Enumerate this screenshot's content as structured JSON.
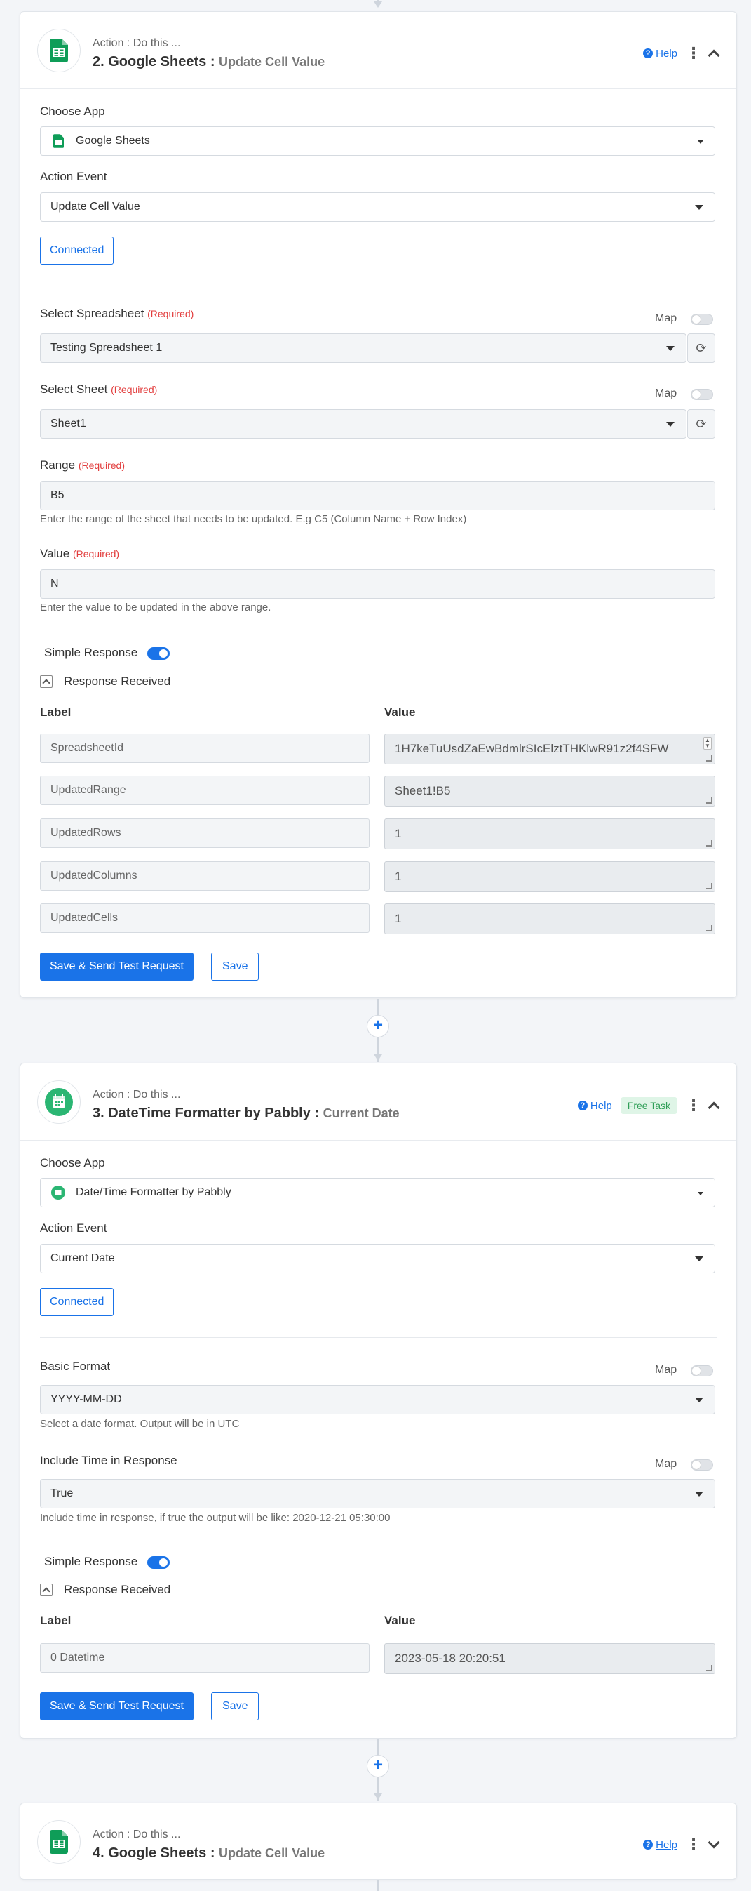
{
  "common": {
    "action_prefix": "Action : Do this ...",
    "help": "Help",
    "free_task": "Free Task",
    "choose_app": "Choose App",
    "action_event": "Action Event",
    "connected": "Connected",
    "map": "Map",
    "required": "(Required)",
    "simple_response": "Simple Response",
    "response_received": "Response Received",
    "col_label": "Label",
    "col_value": "Value",
    "save_send": "Save & Send Test Request",
    "save": "Save",
    "plus": "+"
  },
  "step2": {
    "title": "2. Google Sheets :",
    "event": "Update Cell Value",
    "app": "Google Sheets",
    "action_event_value": "Update Cell Value",
    "spreadsheet_label": "Select Spreadsheet",
    "spreadsheet_value": "Testing Spreadsheet 1",
    "sheet_label": "Select Sheet",
    "sheet_value": "Sheet1",
    "range_label": "Range",
    "range_value": "B5",
    "range_help": "Enter the range of the sheet that needs to be updated. E.g C5 (Column Name + Row Index)",
    "value_label": "Value",
    "value_value": "N",
    "value_help": "Enter the value to be updated in the above range.",
    "response": [
      {
        "label": "SpreadsheetId",
        "value": "1H7keTuUsdZaEwBdmlrSIcElztTHKlwR91z2f4SFW"
      },
      {
        "label": "UpdatedRange",
        "value": "Sheet1!B5"
      },
      {
        "label": "UpdatedRows",
        "value": "1"
      },
      {
        "label": "UpdatedColumns",
        "value": "1"
      },
      {
        "label": "UpdatedCells",
        "value": "1"
      }
    ]
  },
  "step3": {
    "title": "3. DateTime Formatter by Pabbly :",
    "event": "Current Date",
    "app": "Date/Time Formatter by Pabbly",
    "action_event_value": "Current Date",
    "basic_format_label": "Basic Format",
    "basic_format_value": "YYYY-MM-DD",
    "basic_format_help": "Select a date format. Output will be in UTC",
    "include_time_label": "Include Time in Response",
    "include_time_value": "True",
    "include_time_help": "Include time in response, if true the output will be like: 2020-12-21 05:30:00",
    "response": [
      {
        "label": "0 Datetime",
        "value": "2023-05-18 20:20:51"
      }
    ]
  },
  "step4": {
    "title": "4. Google Sheets :",
    "event": "Update Cell Value"
  },
  "colors": {
    "primary": "#1a73e8",
    "sheets_green": "#0f9d58",
    "datetime_green": "#2bb673",
    "required_red": "#e23d3d"
  }
}
